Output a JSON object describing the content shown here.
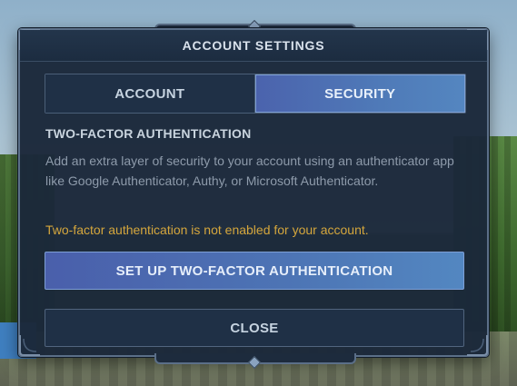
{
  "dialog": {
    "title": "ACCOUNT SETTINGS"
  },
  "tabs": [
    {
      "label": "ACCOUNT",
      "active": false
    },
    {
      "label": "SECURITY",
      "active": true
    }
  ],
  "security": {
    "section_title": "TWO-FACTOR AUTHENTICATION",
    "description": "Add an extra layer of security to your account using an authenticator app like Google Authenticator, Authy, or Microsoft Authenticator.",
    "status_message": "Two-factor authentication is not enabled for your account.",
    "setup_button": "SET UP TWO-FACTOR AUTHENTICATION"
  },
  "footer": {
    "close_button": "CLOSE"
  },
  "colors": {
    "panel_bg": "#1b283a",
    "accent": "#4f7ab8",
    "warning": "#d4a63c",
    "text_muted": "#8e9bab"
  }
}
